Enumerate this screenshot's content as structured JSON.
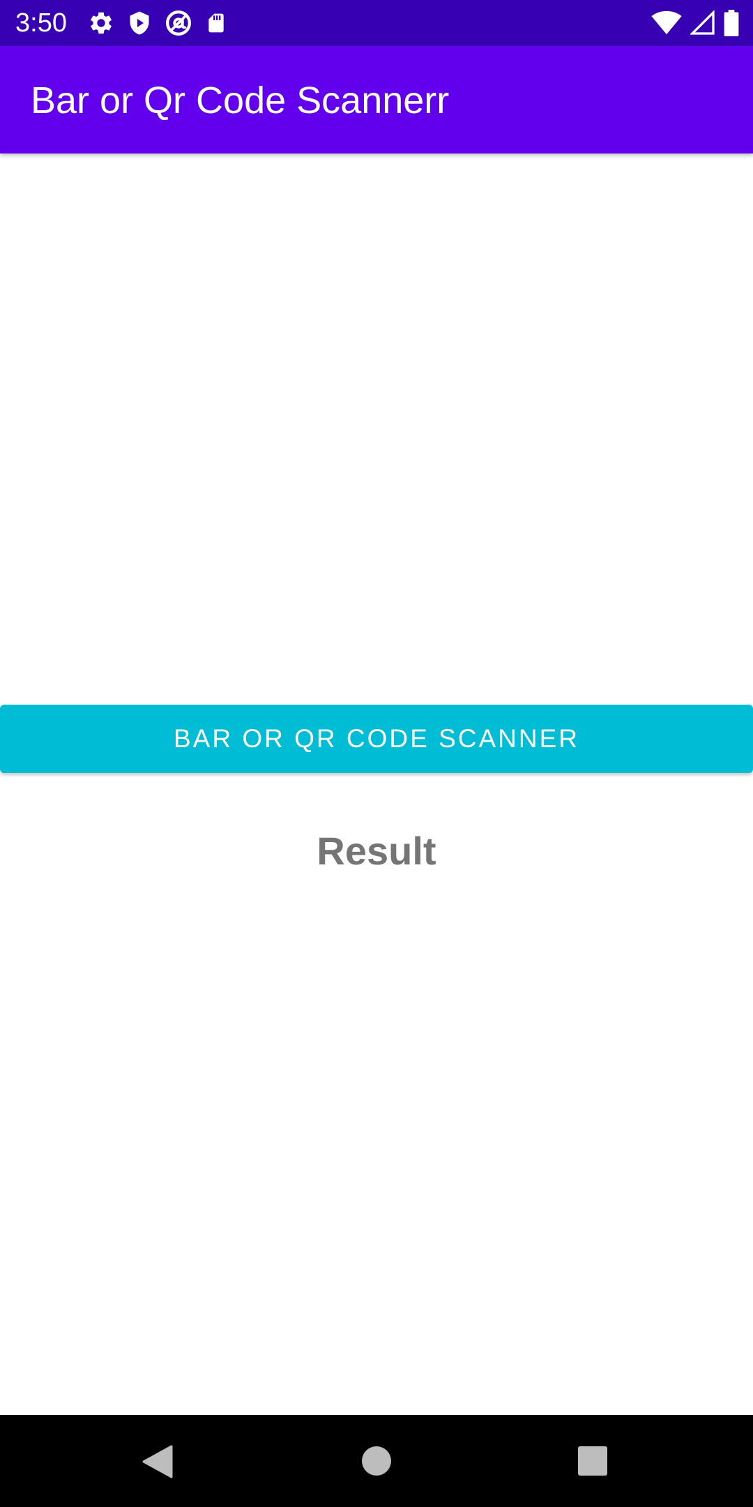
{
  "status_bar": {
    "time": "3:50",
    "left_icons": [
      "settings-gear-icon",
      "shield-play-icon",
      "at-sign-circle-icon",
      "sd-card-icon"
    ],
    "right_icons": [
      "wifi-icon",
      "cell-signal-icon",
      "battery-icon"
    ],
    "background_color": "#3700B3"
  },
  "app_bar": {
    "title": "Bar or Qr Code Scannerr",
    "background_color": "#6200EE"
  },
  "main": {
    "scan_button_label": "BAR OR QR CODE SCANNER",
    "scan_button_color": "#00BCD4",
    "result_label": "Result"
  },
  "nav_bar": {
    "buttons": [
      "back-icon",
      "home-icon",
      "recents-icon"
    ]
  }
}
